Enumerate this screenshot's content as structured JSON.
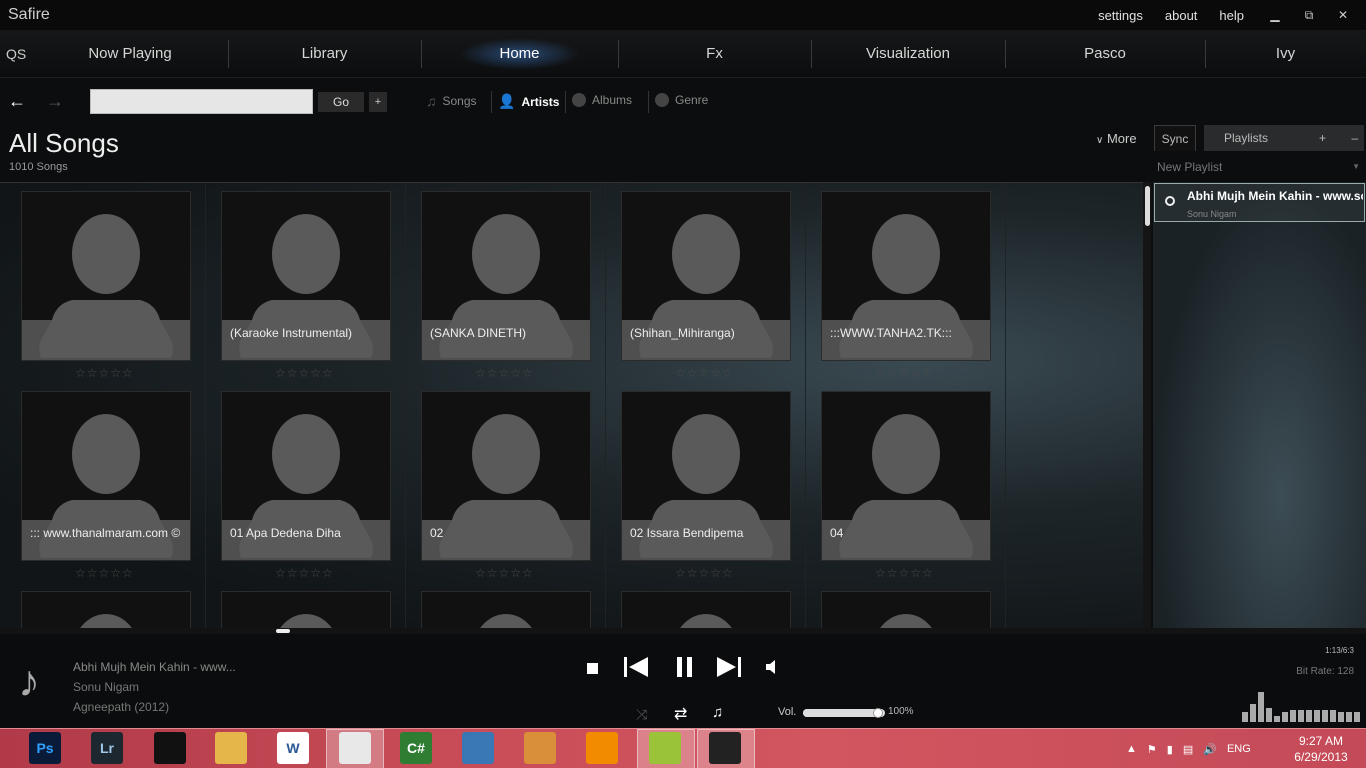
{
  "app": {
    "title": "Safire"
  },
  "top_menu": {
    "settings": "settings",
    "about": "about",
    "help": "help"
  },
  "window_controls": {
    "minimize": "▁",
    "restore": "⧉",
    "close": "✕"
  },
  "nav": {
    "qs": "QS",
    "tabs": [
      "Now Playing",
      "Library",
      "Home",
      "Fx",
      "Visualization",
      "Pasco",
      "Ivy"
    ],
    "active": "Home"
  },
  "search": {
    "value": "",
    "go_label": "Go",
    "add_label": "+"
  },
  "categories": {
    "songs": "Songs",
    "artists": "Artists",
    "albums": "Albums",
    "genre": "Genre",
    "active": "Artists"
  },
  "heading": {
    "title": "All Songs",
    "count": "1010 Songs"
  },
  "panel": {
    "more": "More",
    "sync": "Sync",
    "playlists": "Playlists",
    "add": "+",
    "remove": "–",
    "new_playlist": "New Playlist"
  },
  "grid": {
    "items": [
      {
        "label": ""
      },
      {
        "label": "(Karaoke Instrumental)"
      },
      {
        "label": "(SANKA DINETH)"
      },
      {
        "label": "(Shihan_Mihiranga)"
      },
      {
        "label": ":::WWW.TANHA2.TK:::"
      },
      {
        "label": "::: www.thanalmaram.com ©"
      },
      {
        "label": "01 Apa Dedena Diha"
      },
      {
        "label": "02"
      },
      {
        "label": "02 Issara Bendipema"
      },
      {
        "label": "04"
      },
      {
        "label": ""
      },
      {
        "label": ""
      },
      {
        "label": ""
      },
      {
        "label": ""
      },
      {
        "label": ""
      }
    ],
    "rating_stars": "☆☆☆☆☆",
    "rating": 0
  },
  "playlist": {
    "items": [
      {
        "title": "Abhi Mujh Mein Kahin - www.songs.pk",
        "artist": "Sonu Nigam"
      }
    ]
  },
  "player": {
    "title": "Abhi Mujh Mein Kahin - www...",
    "artist": "Sonu Nigam",
    "album": "Agneepath (2012)",
    "volume_label": "Vol.",
    "volume_value": "100%",
    "volume": 1.0,
    "time": "1:13/6:3",
    "bitrate": "Bit Rate: 128",
    "icons": [
      "music-note-icon",
      "stop-icon",
      "previous-icon",
      "pause-icon",
      "next-icon",
      "volume-icon",
      "shuffle-icon",
      "repeat-icon",
      "note-icon"
    ]
  },
  "taskbar": {
    "apps": [
      "Ps",
      "Lr",
      "Audio",
      "Explorer",
      "W",
      "Chrome",
      "C#",
      "VirtualBox",
      "Paint",
      "VLC",
      "Etisalat",
      "Safire"
    ],
    "language": "ENG",
    "time": "9:27 AM",
    "date": "6/29/2013"
  },
  "colors": {
    "accent": "#3c78c8",
    "taskbar": "#c64b56",
    "cell_bg": "#111111",
    "silhouette": "#5a5a5a"
  }
}
